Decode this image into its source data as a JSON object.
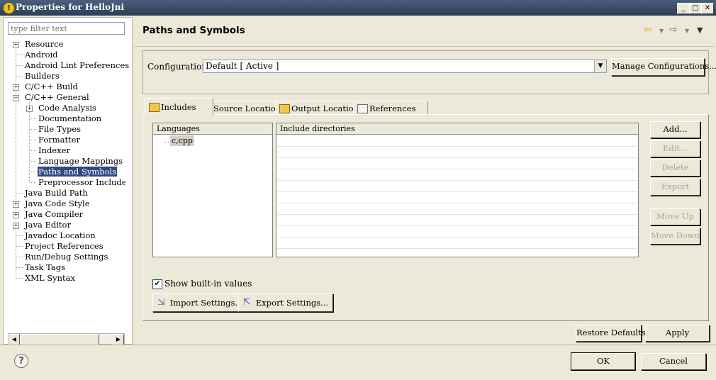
{
  "window": {
    "title": "Properties for HelloJni"
  },
  "filter": {
    "placeholder": "type filter text"
  },
  "tree": {
    "items": [
      {
        "label": "Resource",
        "expander": "+"
      },
      {
        "label": "Android"
      },
      {
        "label": "Android Lint Preferences"
      },
      {
        "label": "Builders"
      },
      {
        "label": "C/C++ Build",
        "expander": "+"
      },
      {
        "label": "C/C++ General",
        "expander": "−"
      },
      {
        "label": "Code Analysis",
        "expander": "+"
      },
      {
        "label": "Documentation"
      },
      {
        "label": "File Types"
      },
      {
        "label": "Formatter"
      },
      {
        "label": "Indexer"
      },
      {
        "label": "Language Mappings"
      },
      {
        "label": "Paths and Symbols"
      },
      {
        "label": "Preprocessor Include Paths"
      },
      {
        "label": "Java Build Path"
      },
      {
        "label": "Java Code Style",
        "expander": "+"
      },
      {
        "label": "Java Compiler",
        "expander": "+"
      },
      {
        "label": "Java Editor",
        "expander": "+"
      },
      {
        "label": "Javadoc Location"
      },
      {
        "label": "Project References"
      },
      {
        "label": "Run/Debug Settings"
      },
      {
        "label": "Task Tags"
      },
      {
        "label": "XML Syntax"
      }
    ]
  },
  "page": {
    "title": "Paths and Symbols"
  },
  "config": {
    "label": "Configuration:",
    "value": "Default  [ Active ]",
    "manage_button": "Manage Configurations..."
  },
  "tabs": [
    {
      "label": "Includes"
    },
    {
      "label": "Source Location"
    },
    {
      "label": "Output Location"
    },
    {
      "label": "References"
    }
  ],
  "languages": {
    "header": "Languages",
    "items": [
      "c,cpp"
    ]
  },
  "includes": {
    "header": "Include directories"
  },
  "side_buttons": {
    "add": "Add...",
    "edit": "Edit...",
    "delete": "Delete",
    "export": "Export",
    "move_up": "Move Up",
    "move_down": "Move Down"
  },
  "show_builtin": {
    "label": "Show built-in values",
    "checked": true
  },
  "import_button": "Import Settings...",
  "export_button": "Export Settings...",
  "restore_button": "Restore Defaults",
  "apply_button": "Apply",
  "ok_button": "OK",
  "cancel_button": "Cancel",
  "colors": {
    "selection": "#2e4a7f",
    "titlebar": "#3a4d6b"
  }
}
